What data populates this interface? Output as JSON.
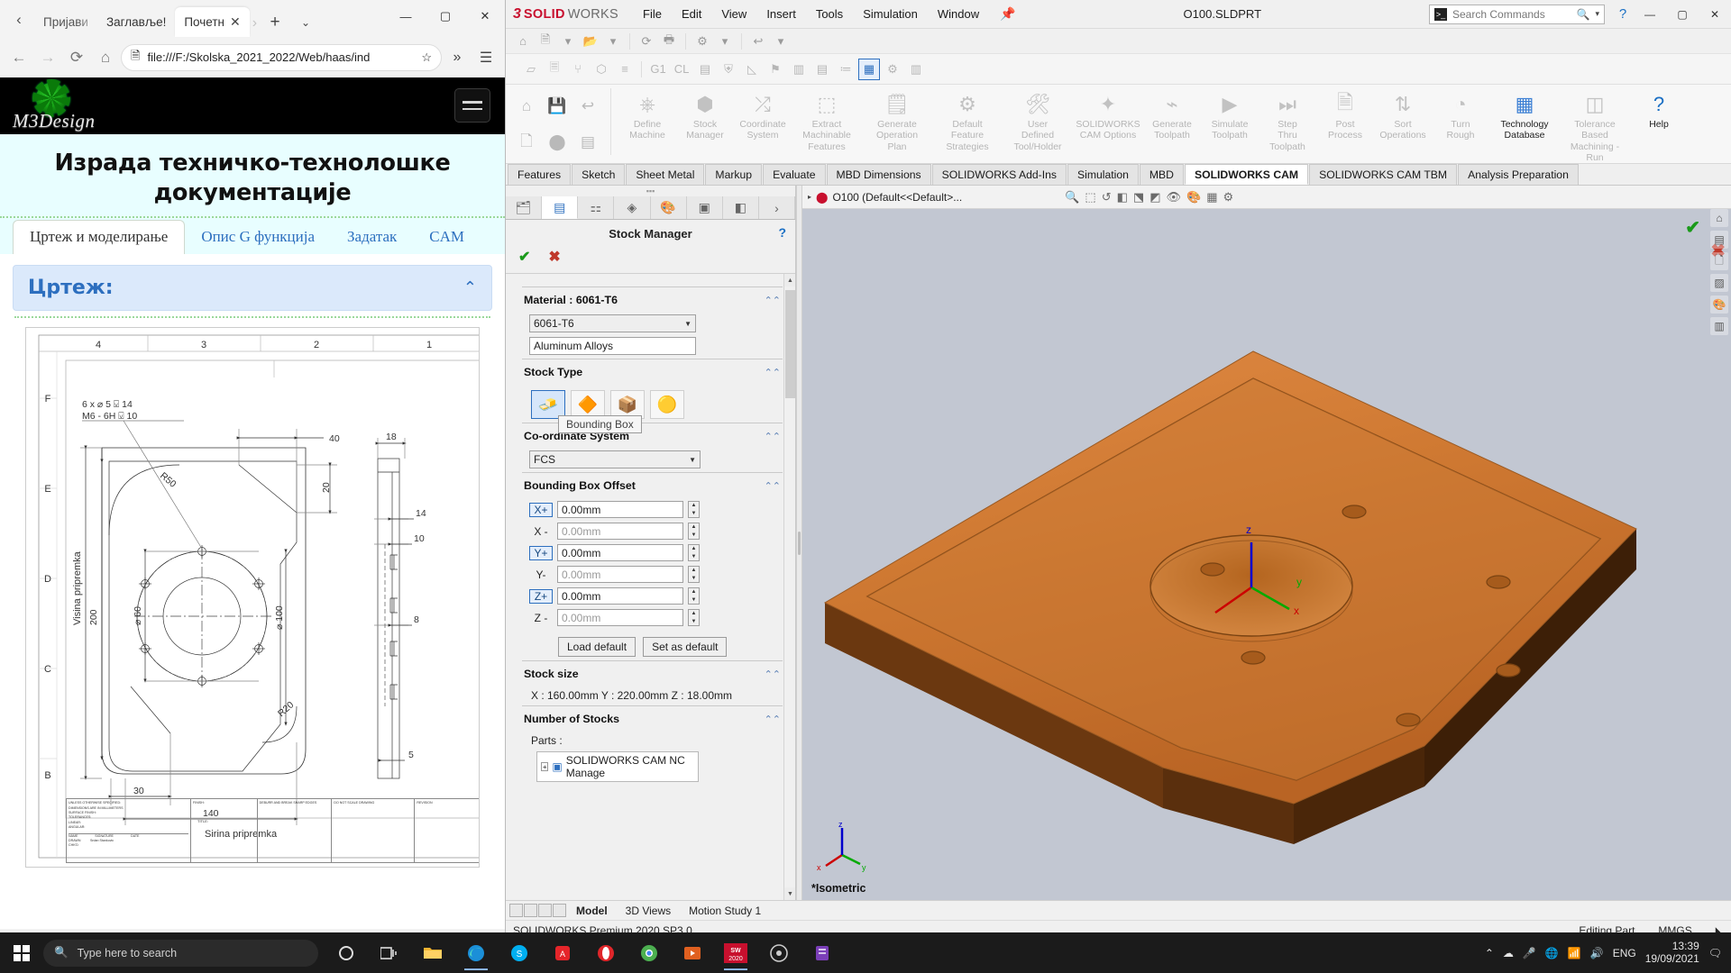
{
  "browser": {
    "tabs": [
      {
        "label": "Пријави",
        "active": false
      },
      {
        "label": "Заглавље!",
        "active": false
      },
      {
        "label": "Почетн",
        "active": true
      }
    ],
    "new_tab_label": "+",
    "tab_menu_label": "⌄",
    "window_controls": {
      "minimize": "—",
      "maximize": "▢",
      "close": "✕"
    },
    "nav": {
      "back": "←",
      "forward": "→",
      "reload": "⟳",
      "home": "⌂",
      "more": "»"
    },
    "address": {
      "url": "file:///F:/Skolska_2021_2022/Web/haas/ind",
      "doc_icon": "page-icon",
      "star_icon": "favorite-icon"
    },
    "page": {
      "logo_text": "M3Design",
      "menu_button": "hamburger-menu",
      "title_line1": "Израда техничко-технолошке",
      "title_line2": "документације",
      "tabs": [
        {
          "label": "Цртеж и моделирање",
          "active": true
        },
        {
          "label": "Опис G функција",
          "active": false
        },
        {
          "label": "Задатак",
          "active": false
        },
        {
          "label": "CAM",
          "active": false
        }
      ],
      "accordion_title": "Цртеж:",
      "accordion_chevron": "chevron-up",
      "drawing": {
        "col_labels": [
          "4",
          "3",
          "2",
          "1"
        ],
        "row_labels": [
          "F",
          "E",
          "D",
          "C",
          "B"
        ],
        "callout_line1": "6 x ⌀ 5 ⍌ 14",
        "callout_line2": "M6 - 6H ⍌ 10",
        "dims": {
          "d40": "40",
          "d20": "20",
          "d200": "200",
          "d140": "140",
          "d30": "30",
          "d18": "18",
          "d14": "14",
          "d10": "10",
          "d8": "8",
          "d5": "5",
          "r50": "R50",
          "r20": "R20",
          "dia60": "⌀ 60",
          "dia100": "⌀ 100"
        },
        "label_height": "Visina pripremka",
        "label_width": "Sirina pripremka",
        "titleblock": {
          "note1": "UNLESS OTHERWISE SPECIFIED:",
          "note2": "DIMENSIONS ARE IN MILLIMETERS",
          "note3": "SURFACE FINISH:",
          "note4": "TOLERANCES:",
          "note5": "LINEAR:",
          "note6": "ANGULAR:",
          "c_finish": "FINISH:",
          "c_deburr": "DEBURR AND BREAK SHARP EDGES",
          "c_donotscale": "DO NOT SCALE DRAWING",
          "c_revision": "REVISION",
          "h_name": "NAME",
          "h_signature": "SIGNATURE",
          "h_date": "DATE",
          "h_title": "TITLE:",
          "r_drawn": "DRAWN",
          "r_chkd": "CHK'D",
          "drawn_by": "Srdan Stankovic"
        }
      }
    }
  },
  "solidworks": {
    "brand": {
      "ds": "⅔S",
      "solid": "SOLID",
      "works": "WORKS"
    },
    "menu": [
      "File",
      "Edit",
      "View",
      "Insert",
      "Tools",
      "Simulation",
      "Window"
    ],
    "pin_icon": "pin-icon",
    "document_title": "O100.SLDPRT",
    "search": {
      "placeholder": "Search Commands",
      "icon": "search-icon",
      "prompt_icon": "command-prompt-icon",
      "dropdown": "▾"
    },
    "help_icon": "help-icon",
    "window_controls": {
      "minimize": "—",
      "maximize": "▢",
      "close": "✕"
    },
    "cam_toolbar_icons": [
      "new-operation-icon",
      "post-process-icon",
      "simulate-icon",
      "shield-icon",
      "step-thru-icon",
      "g1-icon",
      "cl-icon",
      "save-tool-icon",
      "protect-icon",
      "contour-icon",
      "flag-icon",
      "chart-icon",
      "report-icon",
      "list-icon",
      "tech-db-icon",
      "settings-gear-icon",
      "bar-icon",
      "tool-icon"
    ],
    "quick_access_icons": [
      "home-icon",
      "save-icon",
      "undo-icon",
      "new-doc-icon",
      "rebuild-icon",
      "options-icon",
      "file-properties-icon",
      "gear-icon",
      "list-view-icon"
    ],
    "ribbon_buttons": [
      {
        "line1": "Define",
        "line2": "Machine",
        "icon": "define-machine-icon"
      },
      {
        "line1": "Stock",
        "line2": "Manager",
        "icon": "stock-manager-icon"
      },
      {
        "line1": "Coordinate",
        "line2": "System",
        "icon": "coordinate-system-icon"
      },
      {
        "line1": "Extract",
        "line2": "Machinable",
        "line3": "Features",
        "icon": "extract-features-icon"
      },
      {
        "line1": "Generate",
        "line2": "Operation",
        "line3": "Plan",
        "icon": "generate-plan-icon"
      },
      {
        "line1": "Default",
        "line2": "Feature",
        "line3": "Strategies",
        "icon": "default-strategies-icon"
      },
      {
        "line1": "User",
        "line2": "Defined",
        "line3": "Tool/Holder",
        "icon": "user-tool-icon"
      },
      {
        "line1": "SOLIDWORKS",
        "line2": "CAM Options",
        "icon": "cam-options-icon"
      },
      {
        "line1": "Generate",
        "line2": "Toolpath",
        "icon": "generate-toolpath-icon"
      },
      {
        "line1": "Simulate",
        "line2": "Toolpath",
        "icon": "simulate-toolpath-icon"
      },
      {
        "line1": "Step",
        "line2": "Thru",
        "line3": "Toolpath",
        "icon": "step-thru-toolpath-icon"
      },
      {
        "line1": "Post",
        "line2": "Process",
        "icon": "post-process-icon"
      },
      {
        "line1": "Sort",
        "line2": "Operations",
        "icon": "sort-operations-icon"
      },
      {
        "line1": "Turn",
        "line2": "Rough",
        "icon": "turn-rough-icon"
      },
      {
        "line1": "Technology",
        "line2": "Database",
        "icon": "technology-database-icon",
        "active": true
      },
      {
        "line1": "Tolerance Based",
        "line2": "Machining -",
        "line3": "Run",
        "icon": "tolerance-machining-icon"
      },
      {
        "line1": "Help",
        "icon": "help-icon",
        "help": true
      }
    ],
    "tabs": [
      {
        "label": "Features",
        "active": false
      },
      {
        "label": "Sketch",
        "active": false
      },
      {
        "label": "Sheet Metal",
        "active": false
      },
      {
        "label": "Markup",
        "active": false
      },
      {
        "label": "Evaluate",
        "active": false
      },
      {
        "label": "MBD Dimensions",
        "active": false
      },
      {
        "label": "SOLIDWORKS Add-Ins",
        "active": false
      },
      {
        "label": "Simulation",
        "active": false
      },
      {
        "label": "MBD",
        "active": false
      },
      {
        "label": "SOLIDWORKS CAM",
        "active": true
      },
      {
        "label": "SOLIDWORKS CAM TBM",
        "active": false
      },
      {
        "label": "Analysis Preparation",
        "active": false
      }
    ],
    "property_manager": {
      "tabs": [
        "feature-tree-icon",
        "property-manager-icon",
        "configuration-icon",
        "display-manager-icon",
        "cam-tree-icon",
        "cam-operation-icon",
        "appearances-icon"
      ],
      "title": "Stock Manager",
      "help_icon": "help-icon",
      "ok_icon": "✔",
      "cancel_icon": "✖",
      "sections": {
        "material": {
          "heading": "Material : 6061-T6",
          "collapse_icon": "collapse-icon",
          "select_value": "6061-T6",
          "text_value": "Aluminum Alloys"
        },
        "stock_type": {
          "heading": "Stock Type",
          "collapse_icon": "collapse-icon",
          "options": [
            "bounding-box-icon",
            "extruded-sketch-icon",
            "part-file-icon",
            "stl-file-icon"
          ],
          "selected_index": 0,
          "tooltip": "Bounding Box"
        },
        "coordinate_system": {
          "heading": "Co-ordinate System",
          "collapse_icon": "collapse-icon",
          "value": "FCS"
        },
        "bounding_box_offset": {
          "heading": "Bounding Box Offset",
          "collapse_icon": "collapse-icon",
          "rows": [
            {
              "label": "X+",
              "value": "0.00mm",
              "highlight": true,
              "dim": false
            },
            {
              "label": "X -",
              "value": "0.00mm",
              "highlight": false,
              "dim": true
            },
            {
              "label": "Y+",
              "value": "0.00mm",
              "highlight": true,
              "dim": false
            },
            {
              "label": "Y-",
              "value": "0.00mm",
              "highlight": false,
              "dim": true
            },
            {
              "label": "Z+",
              "value": "0.00mm",
              "highlight": true,
              "dim": false
            },
            {
              "label": "Z -",
              "value": "0.00mm",
              "highlight": false,
              "dim": true
            }
          ],
          "load_default": "Load default",
          "set_as_default": "Set as default"
        },
        "stock_size": {
          "heading": "Stock size",
          "collapse_icon": "collapse-icon",
          "value": "X : 160.00mm Y : 220.00mm Z : 18.00mm"
        },
        "number_of_stocks": {
          "heading": "Number of Stocks",
          "collapse_icon": "collapse-icon",
          "parts_label": "Parts :",
          "tree_item": "SOLIDWORKS CAM NC Manage",
          "tree_expand": "+"
        }
      }
    },
    "graphics": {
      "tree_root": "O100 (Default<<Default>...",
      "tree_expand": "▸",
      "part_icon": "part-icon",
      "view_label": "*Isometric",
      "toolbar_icons": [
        "zoom-to-fit-icon",
        "zoom-area-icon",
        "previous-view-icon",
        "section-view-icon",
        "view-orientation-icon",
        "display-style-icon",
        "hide-show-icon",
        "edit-appearance-icon",
        "apply-scene-icon",
        "view-settings-icon"
      ],
      "right_icons": [
        "home-view-icon",
        "view-palette-icon",
        "appearances-icon",
        "decals-icon",
        "scenes-icon",
        "custom-properties-icon"
      ],
      "axis_labels": {
        "x": "x",
        "y": "y",
        "z": "z"
      },
      "triad_labels": {
        "x": "x",
        "y": "y",
        "z": "z"
      }
    },
    "bottom_tabs": [
      {
        "label": "Model",
        "active": true
      },
      {
        "label": "3D Views",
        "active": false
      },
      {
        "label": "Motion Study 1",
        "active": false
      }
    ],
    "status_bar": {
      "left": "SOLIDWORKS Premium 2020 SP3.0",
      "editing": "Editing Part",
      "units": "MMGS"
    }
  },
  "taskbar": {
    "start_icon": "windows-start-icon",
    "search_placeholder": "Type here to search",
    "search_icon": "search-icon",
    "apps": [
      {
        "name": "cortana-icon",
        "active": false
      },
      {
        "name": "task-view-icon",
        "active": false
      },
      {
        "name": "file-explorer-icon",
        "active": false
      },
      {
        "name": "edge-icon",
        "active": true
      },
      {
        "name": "skype-icon",
        "active": false
      },
      {
        "name": "acrobat-icon",
        "active": false
      },
      {
        "name": "opera-icon",
        "active": false
      },
      {
        "name": "chrome-icon",
        "active": false
      },
      {
        "name": "media-player-icon",
        "active": false
      },
      {
        "name": "solidworks-icon",
        "active": true
      },
      {
        "name": "chrome2-icon",
        "active": false
      },
      {
        "name": "notes-icon",
        "active": false
      }
    ],
    "tray": {
      "expand": "⌃",
      "onedrive": "cloud-icon",
      "network": "network-icon",
      "mic": "mic-icon",
      "globe": "globe-icon",
      "speaker": "speaker-icon",
      "language": "ENG",
      "time": "13:39",
      "date": "19/09/2021",
      "action_center": "action-center-icon"
    }
  }
}
